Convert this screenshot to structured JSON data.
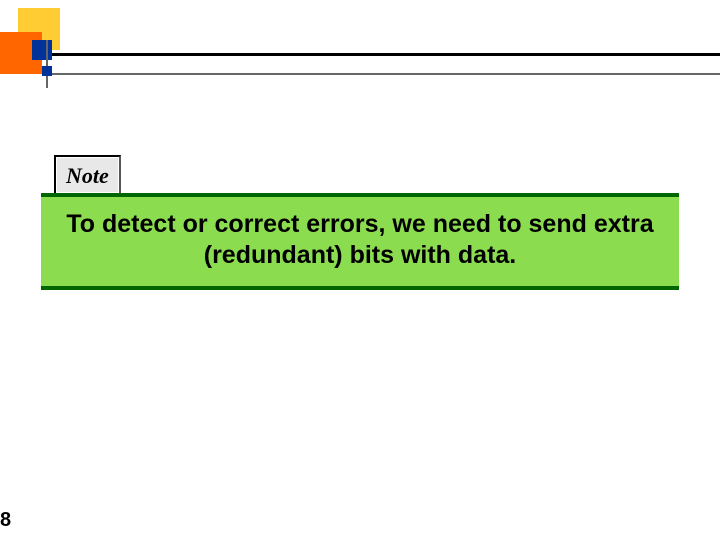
{
  "note_label": "Note",
  "banner_text": "To detect or correct errors, we need to send extra (redundant) bits with data.",
  "page_number": "8",
  "colors": {
    "yellow": "#ffcc33",
    "orange": "#ff6600",
    "blue": "#003399",
    "banner_bg": "#8cdc50",
    "banner_border": "#006600"
  }
}
